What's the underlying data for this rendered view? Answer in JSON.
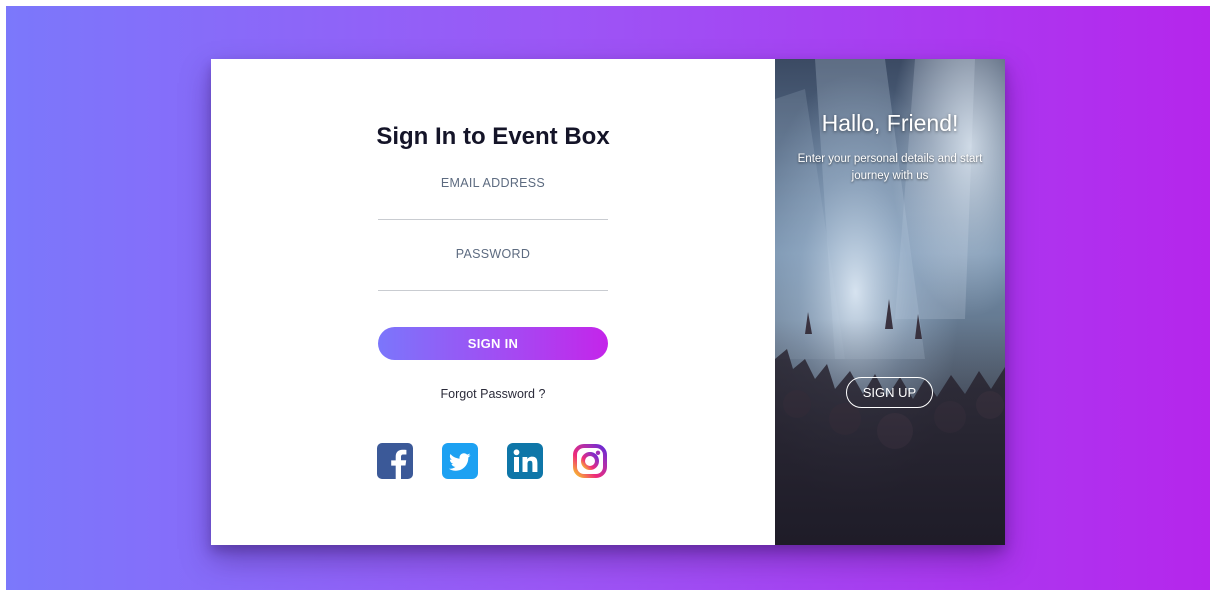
{
  "left_panel": {
    "title": "Sign In to Event Box",
    "email_label": "EMAIL ADDRESS",
    "email_value": "",
    "password_label": "PASSWORD",
    "password_value": "",
    "signin_label": "SIGN IN",
    "forgot_label": "Forgot Password ?",
    "socials": [
      {
        "name": "facebook-icon",
        "color": "#3b5998"
      },
      {
        "name": "twitter-icon",
        "color": "#1da1f2"
      },
      {
        "name": "linkedin-icon",
        "color": "#0e76a8"
      },
      {
        "name": "instagram-icon",
        "color": "#c13584"
      }
    ]
  },
  "right_panel": {
    "heading": "Hallo, Friend!",
    "subtext": "Enter your personal details and start journey with us",
    "signup_label": "SIGN UP"
  },
  "colors": {
    "gradient_start": "#7b78fb",
    "gradient_end": "#b526ec"
  }
}
